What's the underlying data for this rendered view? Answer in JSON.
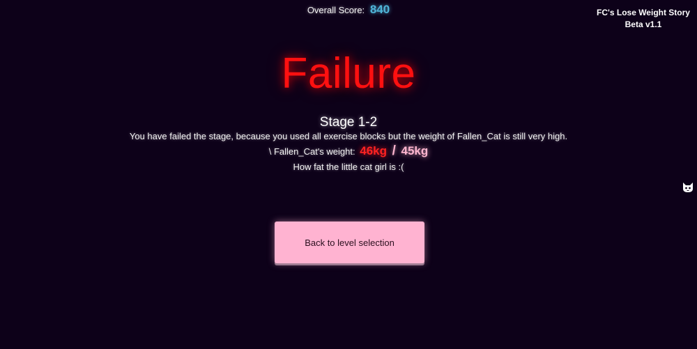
{
  "score": {
    "label": "Overall Score:",
    "value": "840"
  },
  "game": {
    "title": "FC's Lose Weight Story",
    "version": "Beta v1.1"
  },
  "result": {
    "heading": "Failure",
    "stage": "Stage 1-2",
    "reason": "You have failed the stage, because you used all exercise blocks but the weight of Fallen_Cat is still very high.",
    "weight_label": "\\ Fallen_Cat's weight:",
    "weight_current": "46kg",
    "weight_separator": "/",
    "weight_target": "45kg",
    "taunt": "How fat the little cat girl is :("
  },
  "actions": {
    "back_label": "Back to level selection"
  },
  "icons": {
    "side": "cat-icon"
  },
  "colors": {
    "background": "#0d0119",
    "failure": "#ff1010",
    "score": "#4fb4d8",
    "weight_current": "#ff2222",
    "weight_target": "#ffb6d0",
    "button": "#ffb3d1"
  }
}
